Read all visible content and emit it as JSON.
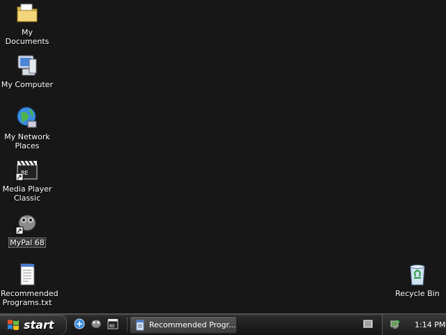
{
  "desktop": {
    "icons": [
      {
        "label": "My Documents",
        "icon": "folder-documents-icon"
      },
      {
        "label": "My Computer",
        "icon": "computer-icon"
      },
      {
        "label_line1": "My Network",
        "label_line2": "Places",
        "icon": "network-places-icon"
      },
      {
        "label_line1": "Media Player",
        "label_line2": "Classic",
        "icon": "media-player-classic-icon"
      },
      {
        "label": "MyPal 68",
        "icon": "mypal-icon",
        "selected": true
      },
      {
        "label_line1": "Recommended",
        "label_line2": "Programs.txt",
        "icon": "text-file-icon"
      },
      {
        "label": "Recycle Bin",
        "icon": "recycle-bin-icon"
      }
    ]
  },
  "taskbar": {
    "start_label": "start",
    "quick_launch": [
      "browser-icon",
      "mypal-quicklaunch-icon",
      "media-player-quicklaunch-icon"
    ],
    "task_button_label": "Recommended Progr...",
    "clock": "1:14 PM"
  },
  "colors": {
    "desktop_bg": "#171717",
    "taskbar_bg": "#1e1e1e"
  }
}
